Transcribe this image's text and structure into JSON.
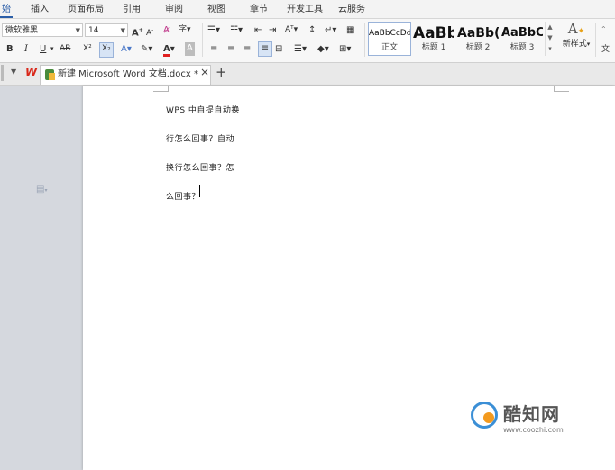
{
  "menu": {
    "tabs": [
      {
        "label": "始",
        "active": true
      },
      {
        "label": "插入"
      },
      {
        "label": "页面布局"
      },
      {
        "label": "引用"
      },
      {
        "label": "审阅"
      },
      {
        "label": "视图"
      },
      {
        "label": "章节"
      },
      {
        "label": "开发工具"
      },
      {
        "label": "云服务"
      }
    ]
  },
  "ribbon": {
    "font_name": "微软雅黑",
    "font_size": "14",
    "bold": "B",
    "italic": "I",
    "underline": "U",
    "strike": "AB",
    "superscript": "X²",
    "subscript": "X₂",
    "font_color_letter": "A",
    "styles": [
      {
        "preview": "AaBbCcDd",
        "name": "正文",
        "selected": true
      },
      {
        "preview": "AaBb",
        "name": "标题 1"
      },
      {
        "preview": "AaBb(",
        "name": "标题 2"
      },
      {
        "preview": "AaBbC",
        "name": "标题 3"
      }
    ],
    "new_style_label": "新样式",
    "more_label": "文"
  },
  "tabbar": {
    "doc_title": "新建 Microsoft Word 文档.docx *",
    "close_glyph": "×",
    "new_tab_glyph": "+"
  },
  "document": {
    "paragraphs": [
      "WPS 中自提自动换",
      "行怎么回事？自动",
      "换行怎么回事？怎",
      "么回事？"
    ]
  },
  "watermark": {
    "brand": "酷知网",
    "url": "www.coozhi.com"
  },
  "colors": {
    "accent": "#2b5ea8",
    "logo_red": "#d9281a",
    "watermark_blue": "#3b8fd6",
    "watermark_orange": "#f39a1e"
  }
}
